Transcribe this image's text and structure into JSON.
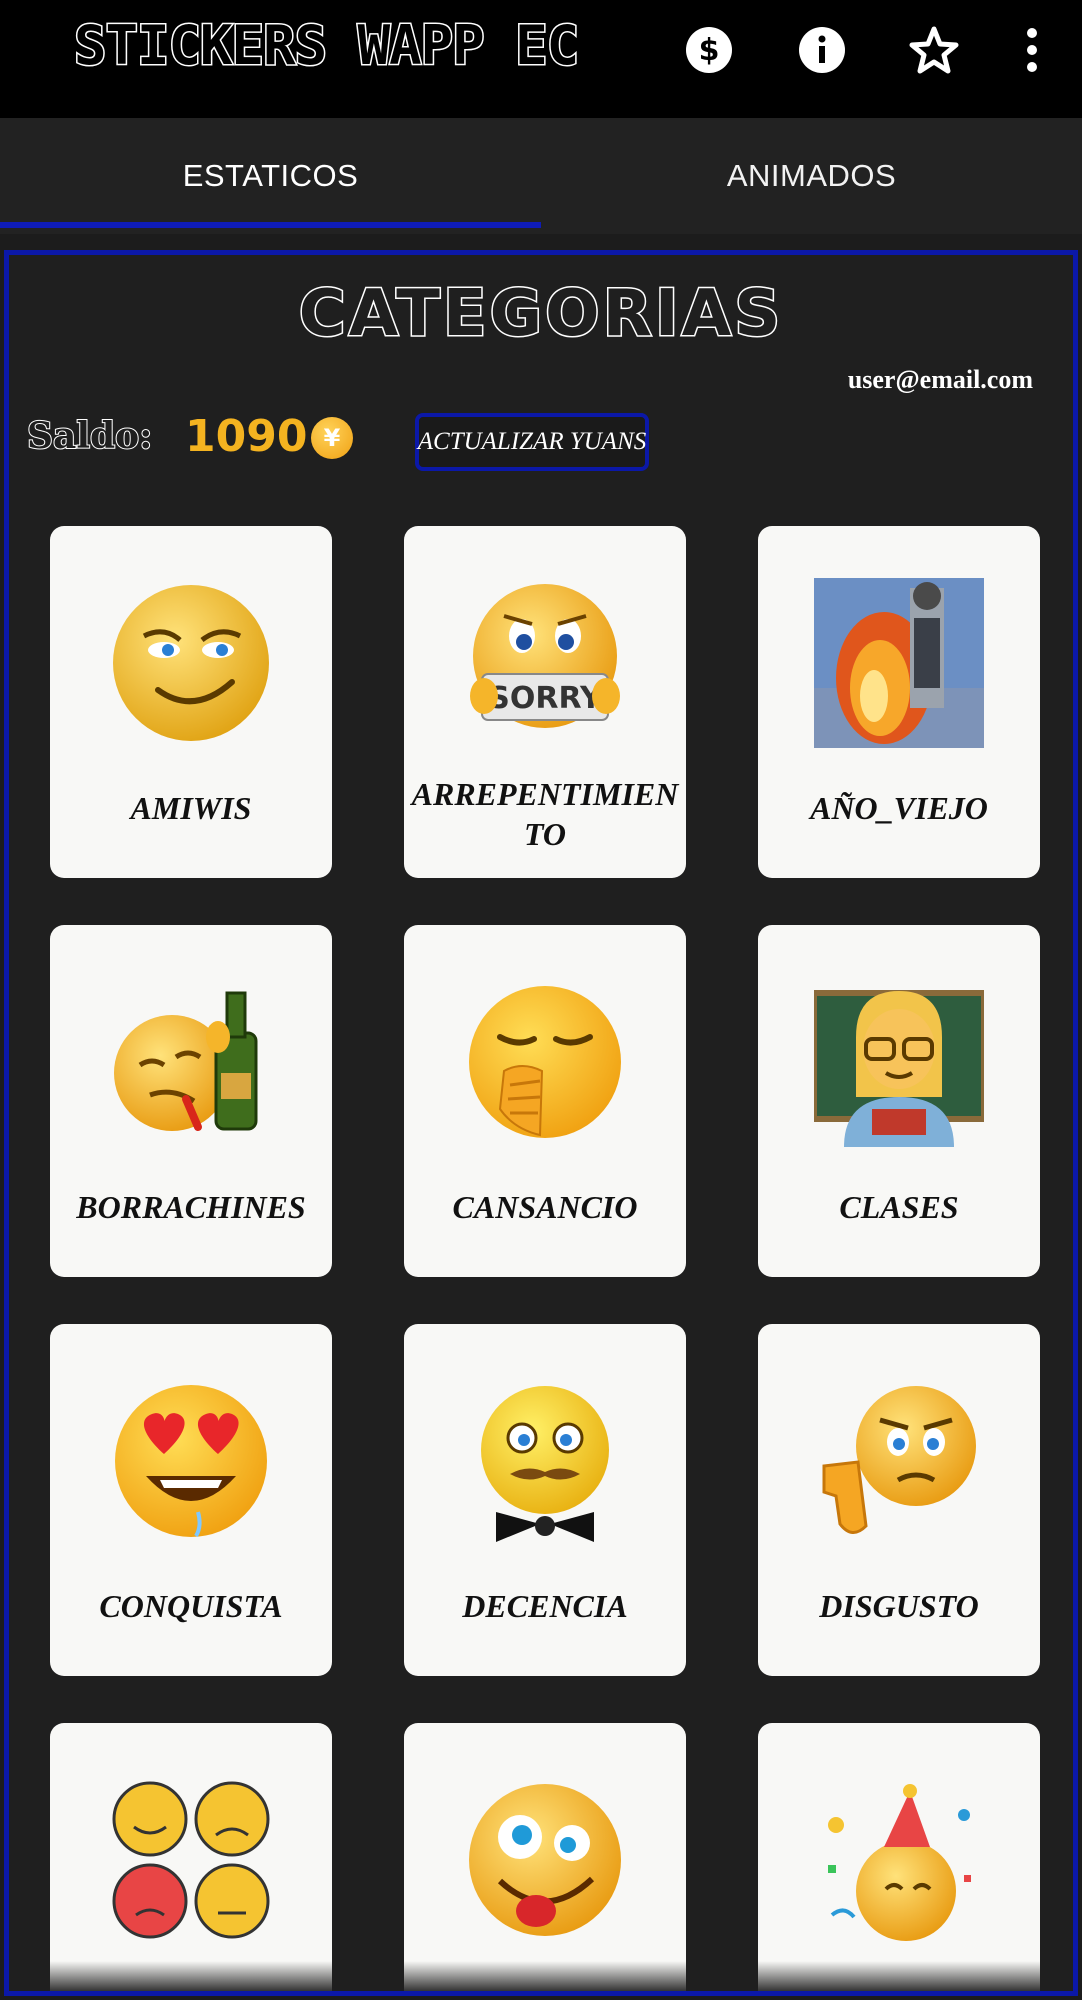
{
  "app": {
    "title": "STICKERS WAPP EC",
    "actions": [
      {
        "name": "dollar-icon"
      },
      {
        "name": "info-icon"
      },
      {
        "name": "star-icon"
      },
      {
        "name": "more-vert-icon"
      }
    ]
  },
  "tabs": [
    {
      "label": "ESTATICOS",
      "selected": true
    },
    {
      "label": "ANIMADOS",
      "selected": false
    }
  ],
  "colors": {
    "accent": "#0b18a8",
    "saldo": "#f4b320",
    "card_bg": "#f8f8f6"
  },
  "header": {
    "title": "CATEGORIAS",
    "email": "user@email.com",
    "saldo_label": "Saldo:",
    "saldo_value": "1090",
    "coin_symbol": "¥",
    "update_button": "ACTUALIZAR YUANS"
  },
  "categories": [
    {
      "label": "AMIWIS",
      "icon": "smirk-emoji-icon"
    },
    {
      "label": "ARREPENTIMIENTO",
      "icon": "sorry-emoji-icon"
    },
    {
      "label": "AÑO_VIEJO",
      "icon": "burning-effigy-photo"
    },
    {
      "label": "BORRACHINES",
      "icon": "drunk-emoji-icon"
    },
    {
      "label": "CANSANCIO",
      "icon": "yawning-emoji-icon"
    },
    {
      "label": "CLASES",
      "icon": "teacher-emoji-icon"
    },
    {
      "label": "CONQUISTA",
      "icon": "heart-eyes-emoji-icon"
    },
    {
      "label": "DECENCIA",
      "icon": "gentleman-emoji-icon"
    },
    {
      "label": "DISGUSTO",
      "icon": "thumbs-down-emoji-icon"
    },
    {
      "label": "",
      "icon": "four-faces-emoji-icon"
    },
    {
      "label": "",
      "icon": "crazy-tongue-emoji-icon"
    },
    {
      "label": "",
      "icon": "party-emoji-icon"
    }
  ]
}
